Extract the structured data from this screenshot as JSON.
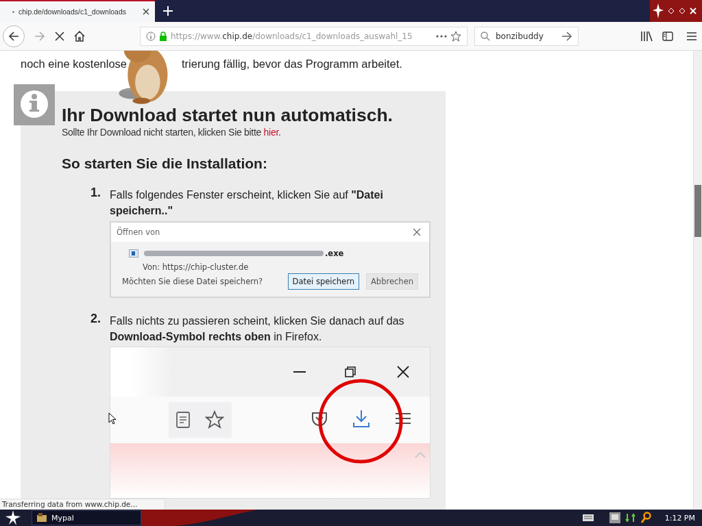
{
  "browser": {
    "tab": {
      "title": "chip.de/downloads/c1_downloads",
      "loading": true
    },
    "url": {
      "scheme": "https://www.",
      "domain": "chip.de",
      "path": "/downloads/c1_downloads_auswahl_15"
    },
    "search": {
      "value": "bonzibuddy"
    }
  },
  "article": {
    "intro_left": "noch eine kostenlose",
    "intro_right": "trierung fällig, bevor das Programm arbeitet.",
    "heading": "Ihr Download startet nun automatisch.",
    "subline": "Sollte Ihr Download nicht starten, klicken Sie bitte ",
    "link": "hier",
    "subline_end": ".",
    "steps_heading": "So starten Sie die Installation:",
    "steps": [
      {
        "number": "1.",
        "text": "Falls folgendes Fenster erscheint, klicken Sie auf **\"Datei speichern..\"**",
        "kind": "dialog"
      },
      {
        "number": "2.",
        "text": "Falls nichts zu passieren scheint, klicken Sie danach auf das **Download-Symbol rechts oben** in Firefox.",
        "kind": "toolbar"
      }
    ]
  },
  "dialog": {
    "title": "Öffnen von",
    "file_ext": ".exe",
    "source": "Von: https://chip-cluster.de",
    "question": "Möchten Sie diese Datei speichern?",
    "buttons": [
      {
        "label": "Datei speichern",
        "selected": true
      },
      {
        "label": "Abbrechen",
        "selected": false
      }
    ]
  },
  "status": "Transferring data from www.chip.de...",
  "taskbar": {
    "task": "Mypal",
    "clock": "1:12 PM"
  }
}
